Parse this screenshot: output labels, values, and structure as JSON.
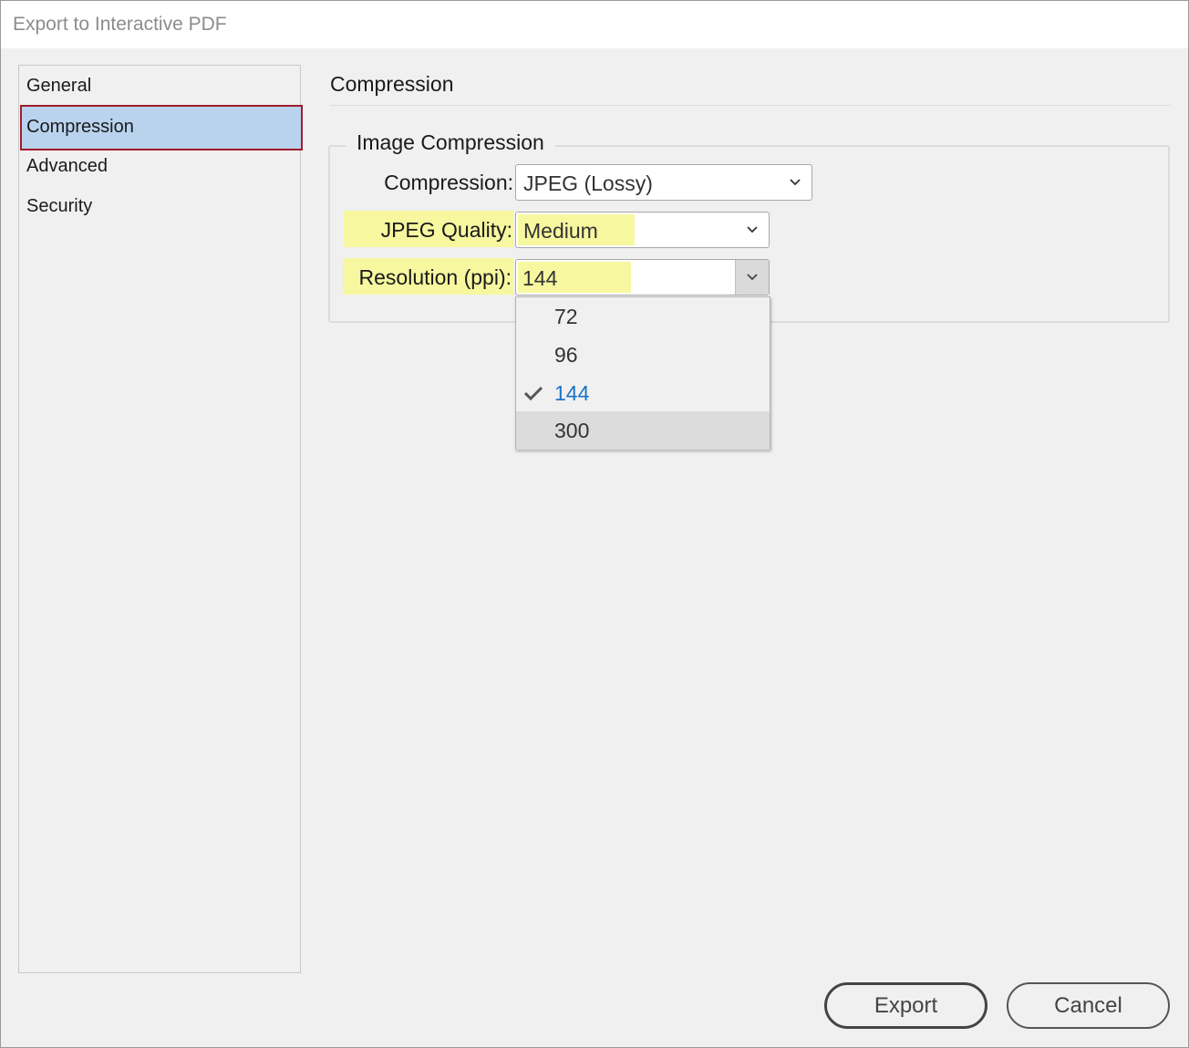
{
  "window": {
    "title": "Export to Interactive PDF"
  },
  "sidebar": {
    "items": [
      {
        "label": "General",
        "selected": false
      },
      {
        "label": "Compression",
        "selected": true
      },
      {
        "label": "Advanced",
        "selected": false
      },
      {
        "label": "Security",
        "selected": false
      }
    ]
  },
  "panel": {
    "title": "Compression",
    "group_title": "Image Compression",
    "compression": {
      "label": "Compression:",
      "value": "JPEG (Lossy)"
    },
    "jpeg_quality": {
      "label": "JPEG Quality:",
      "value": "Medium"
    },
    "resolution": {
      "label": "Resolution (ppi):",
      "value": "144",
      "options": [
        "72",
        "96",
        "144",
        "300"
      ],
      "checked": "144",
      "hovered": "300"
    }
  },
  "buttons": {
    "export": "Export",
    "cancel": "Cancel"
  },
  "colors": {
    "highlight": "#f7f7a0",
    "selected_bg": "#b9d3ee",
    "selected_border": "#a01c2c",
    "checked_text": "#1a73c8"
  }
}
